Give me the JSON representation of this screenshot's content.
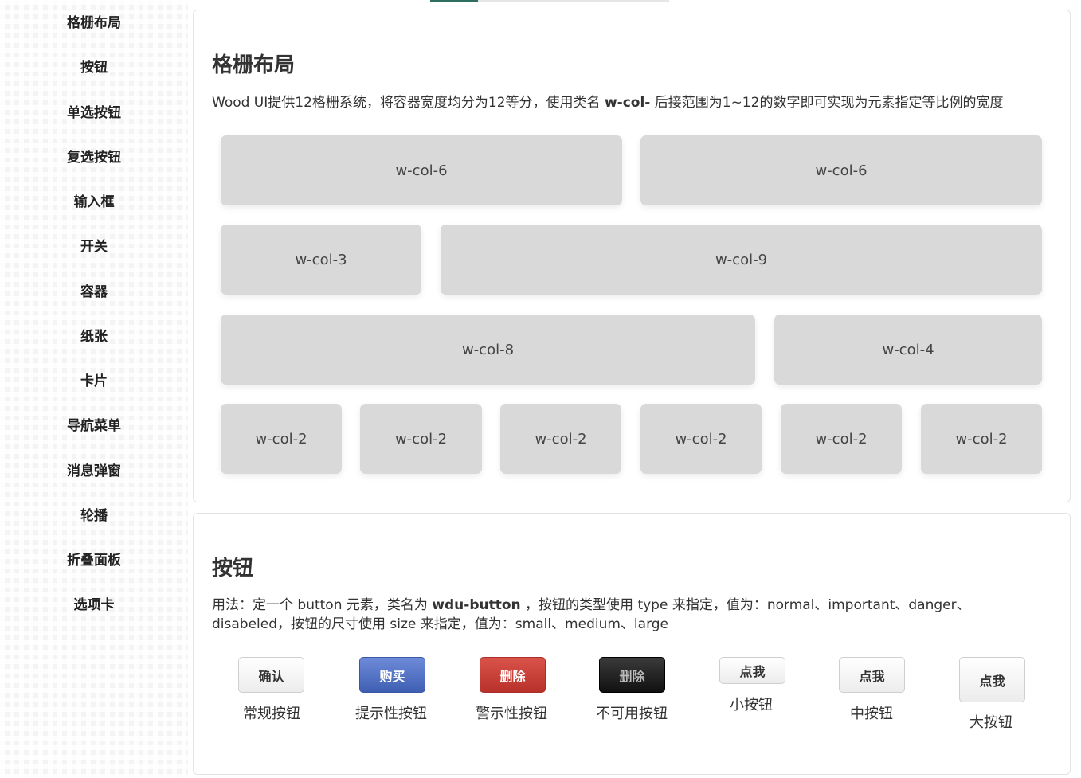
{
  "sidebar": {
    "items": [
      {
        "label": "格栅布局"
      },
      {
        "label": "按钮"
      },
      {
        "label": "单选按钮"
      },
      {
        "label": "复选按钮"
      },
      {
        "label": "输入框"
      },
      {
        "label": "开关"
      },
      {
        "label": "容器"
      },
      {
        "label": "纸张"
      },
      {
        "label": "卡片"
      },
      {
        "label": "导航菜单"
      },
      {
        "label": "消息弹窗"
      },
      {
        "label": "轮播"
      },
      {
        "label": "折叠面板"
      },
      {
        "label": "选项卡"
      }
    ]
  },
  "grid": {
    "title": "格栅布局",
    "desc_before": "Wood UI提供12格栅系统，将容器宽度均分为12等分，使用类名 ",
    "desc_class": "w-col-",
    "desc_after": " 后接范围为1~12的数字即可实现为元素指定等比例的宽度",
    "rows": [
      [
        "w-col-6",
        "w-col-6"
      ],
      [
        "w-col-3",
        "w-col-9"
      ],
      [
        "w-col-8",
        "w-col-4"
      ],
      [
        "w-col-2",
        "w-col-2",
        "w-col-2",
        "w-col-2",
        "w-col-2",
        "w-col-2"
      ]
    ]
  },
  "buttons": {
    "title": "按钮",
    "desc_before": "用法：定一个 button 元素，类名为 ",
    "desc_class": "wdu-button",
    "desc_after": " ，按钮的类型使用 type 来指定，值为：normal、important、danger、disabeled，按钮的尺寸使用 size 来指定，值为：small、medium、large",
    "items": [
      {
        "label": "确认",
        "caption": "常规按钮"
      },
      {
        "label": "购买",
        "caption": "提示性按钮"
      },
      {
        "label": "删除",
        "caption": "警示性按钮"
      },
      {
        "label": "删除",
        "caption": "不可用按钮"
      },
      {
        "label": "点我",
        "caption": "小按钮"
      },
      {
        "label": "点我",
        "caption": "中按钮"
      },
      {
        "label": "点我",
        "caption": "大按钮"
      }
    ]
  }
}
